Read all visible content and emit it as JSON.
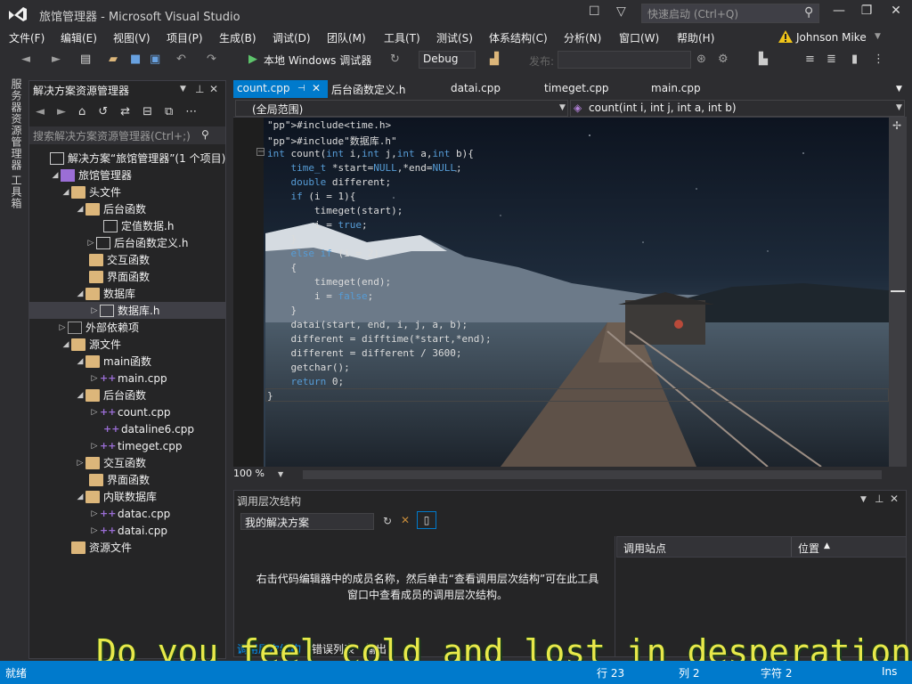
{
  "window": {
    "title": "旅馆管理器 - Microsoft Visual Studio",
    "quick_launch_placeholder": "快速启动 (Ctrl+Q)",
    "user": "Johnson Mike"
  },
  "menu": [
    "文件(F)",
    "编辑(E)",
    "视图(V)",
    "项目(P)",
    "生成(B)",
    "调试(D)",
    "团队(M)",
    "工具(T)",
    "测试(S)",
    "体系结构(C)",
    "分析(N)",
    "窗口(W)",
    "帮助(H)"
  ],
  "toolbar": {
    "debug_target": "本地 Windows 调试器",
    "configuration": "Debug",
    "publish_label": "发布:"
  },
  "left_rail": [
    "服务器资源管理器",
    "工具箱"
  ],
  "solution_explorer": {
    "title": "解决方案资源管理器",
    "search_placeholder": "搜索解决方案资源管理器(Ctrl+;)",
    "items": [
      {
        "label": "解决方案“旅馆管理器”(1 个项目)",
        "icon": "solution-icon",
        "expand": ""
      },
      {
        "label": "旅馆管理器",
        "icon": "project-icon",
        "expand": "▲"
      },
      {
        "label": "头文件",
        "icon": "folder-icon",
        "expand": "▲"
      },
      {
        "label": "后台函数",
        "icon": "folder-icon",
        "expand": "▲"
      },
      {
        "label": "定值数据.h",
        "icon": "header-file-icon",
        "expand": ""
      },
      {
        "label": "后台函数定义.h",
        "icon": "header-file-icon",
        "expand": "▷"
      },
      {
        "label": "交互函数",
        "icon": "folder-icon",
        "expand": ""
      },
      {
        "label": "界面函数",
        "icon": "folder-icon",
        "expand": ""
      },
      {
        "label": "数据库",
        "icon": "folder-icon",
        "expand": "▲"
      },
      {
        "label": "数据库.h",
        "icon": "header-file-icon",
        "expand": "▷"
      },
      {
        "label": "外部依赖项",
        "icon": "dependency-icon",
        "expand": "▷"
      },
      {
        "label": "源文件",
        "icon": "folder-icon",
        "expand": "▲"
      },
      {
        "label": "main函数",
        "icon": "folder-icon",
        "expand": "▲"
      },
      {
        "label": "main.cpp",
        "icon": "cpp-file-icon",
        "expand": "▷"
      },
      {
        "label": "后台函数",
        "icon": "folder-icon",
        "expand": "▲"
      },
      {
        "label": "count.cpp",
        "icon": "cpp-file-icon",
        "expand": "▷"
      },
      {
        "label": "dataline6.cpp",
        "icon": "cpp-file-icon",
        "expand": ""
      },
      {
        "label": "timeget.cpp",
        "icon": "cpp-file-icon",
        "expand": "▷"
      },
      {
        "label": "交互函数",
        "icon": "folder-icon",
        "expand": "▷"
      },
      {
        "label": "界面函数",
        "icon": "folder-icon",
        "expand": ""
      },
      {
        "label": "内联数据库",
        "icon": "folder-icon",
        "expand": "▲"
      },
      {
        "label": "datac.cpp",
        "icon": "cpp-file-icon",
        "expand": "▷"
      },
      {
        "label": "datai.cpp",
        "icon": "cpp-file-icon",
        "expand": "▷"
      },
      {
        "label": "资源文件",
        "icon": "folder-icon",
        "expand": ""
      }
    ]
  },
  "editor": {
    "tabs": [
      "count.cpp",
      "后台函数定义.h",
      "datai.cpp",
      "timeget.cpp",
      "main.cpp"
    ],
    "scope": "(全局范围)",
    "member": "count(int i, int j, int a, int b)",
    "zoom": "100 %",
    "code": [
      "#include<time.h>",
      "#include\"数据库.h\"",
      "int count(int i,int j,int a,int b){",
      "    time_t *start=NULL,*end=NULL;",
      "    double different;",
      "    if (i = 1){",
      "        timeget(start);",
      "        i = true;",
      "    }",
      "    else if (i = 2)",
      "    {",
      "        timeget(end);",
      "        i = false;",
      "    }",
      "    datai(start, end, i, j, a, b);",
      "    different = difftime(*start,*end);",
      "    different = different / 3600;",
      "    getchar();",
      "    return 0;",
      "}"
    ]
  },
  "call_hierarchy": {
    "title": "调用层次结构",
    "scope": "我的解决方案",
    "message_line1": "右击代码编辑器中的成员名称，然后单击“查看调用层次结构”可在此工具",
    "message_line2": "窗口中查看成员的调用层次结构。",
    "col_site": "调用站点",
    "col_position": "位置",
    "bottom_tabs": [
      "调用层次结构",
      "错误列表",
      "输出"
    ]
  },
  "subtitle": "Do you feel cold and lost in desperation",
  "status": {
    "ready": "就绪",
    "line": "行 23",
    "col": "列 2",
    "char": "字符 2",
    "mode": "Ins"
  },
  "colors": {
    "accent": "#007acc",
    "subtitle": "#e8e84a"
  }
}
